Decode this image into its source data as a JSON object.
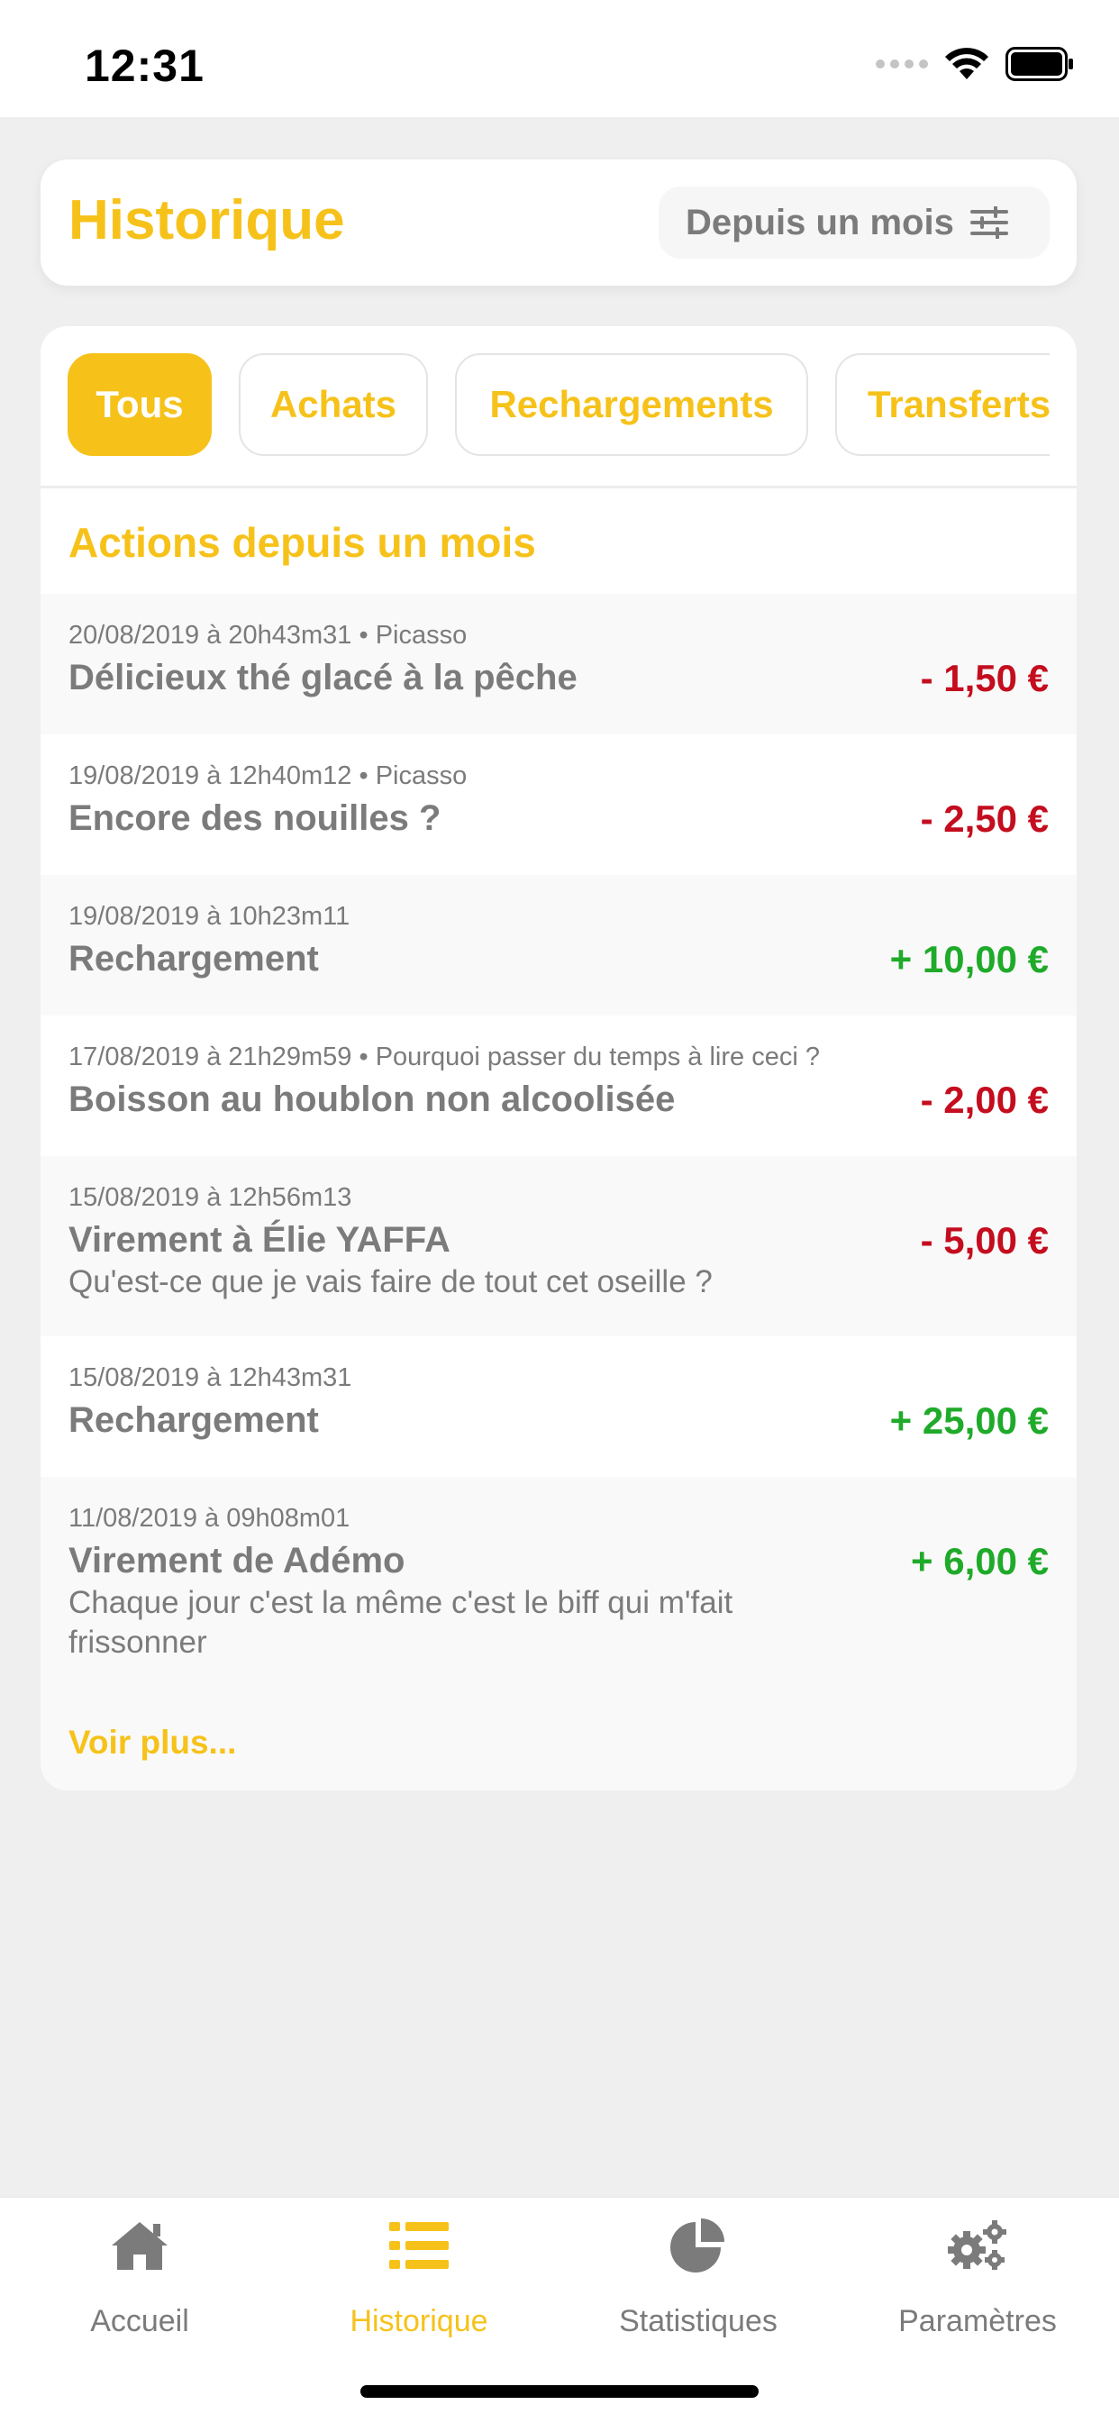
{
  "status_bar": {
    "time": "12:31"
  },
  "header": {
    "title": "Historique",
    "period_label": "Depuis un mois",
    "period_icon": "sliders-icon"
  },
  "tabs": [
    {
      "label": "Tous",
      "active": true
    },
    {
      "label": "Achats",
      "active": false
    },
    {
      "label": "Rechargements",
      "active": false
    },
    {
      "label": "Transferts",
      "active": false
    }
  ],
  "section_title": "Actions depuis un mois",
  "transactions": [
    {
      "meta": "20/08/2019 à 20h43m31 • Picasso",
      "title": "Délicieux thé glacé à la pêche",
      "comment": "",
      "amount": "- 1,50 €",
      "type": "debit"
    },
    {
      "meta": "19/08/2019 à 12h40m12 • Picasso",
      "title": "Encore des nouilles ?",
      "comment": "",
      "amount": "- 2,50 €",
      "type": "debit"
    },
    {
      "meta": "19/08/2019 à 10h23m11",
      "title": "Rechargement",
      "comment": "",
      "amount": "+ 10,00 €",
      "type": "credit"
    },
    {
      "meta": "17/08/2019 à 21h29m59 • Pourquoi passer du temps à lire ceci ?",
      "title": "Boisson au houblon non alcoolisée",
      "comment": "",
      "amount": "- 2,00 €",
      "type": "debit"
    },
    {
      "meta": "15/08/2019 à 12h56m13",
      "title": "Virement à Élie YAFFA",
      "comment": "Qu'est-ce que je vais faire de tout cet oseille ?",
      "amount": "- 5,00 €",
      "type": "debit"
    },
    {
      "meta": "15/08/2019 à 12h43m31",
      "title": "Rechargement",
      "comment": "",
      "amount": "+ 25,00 €",
      "type": "credit"
    },
    {
      "meta": "11/08/2019 à 09h08m01",
      "title": "Virement de Adémo",
      "comment": "Chaque jour c'est la même c'est le biff qui m'fait frissonner",
      "amount": "+ 6,00 €",
      "type": "credit"
    }
  ],
  "see_more": "Voir plus...",
  "nav": [
    {
      "label": "Accueil",
      "icon": "home-icon",
      "active": false
    },
    {
      "label": "Historique",
      "icon": "list-icon",
      "active": true
    },
    {
      "label": "Statistiques",
      "icon": "pie-chart-icon",
      "active": false
    },
    {
      "label": "Paramètres",
      "icon": "gears-icon",
      "active": false
    }
  ],
  "colors": {
    "accent": "#f6c21a",
    "debit": "#c40d1e",
    "credit": "#1faa2a",
    "text": "#7b7b7b",
    "background": "#efefef"
  }
}
